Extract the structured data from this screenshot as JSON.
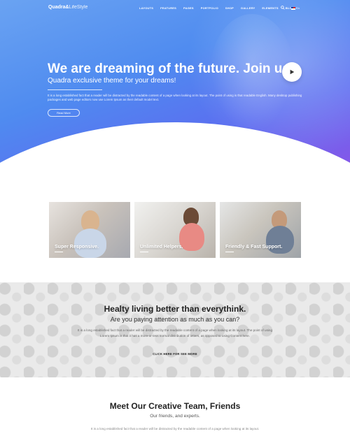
{
  "nav": {
    "logo_bold": "Quadra&",
    "logo_light": "LifeStyle",
    "menu": [
      "LAYOUTS",
      "FEATURES",
      "PAGES",
      "PORTFOLIO",
      "SHOP",
      "GALLERY",
      "ELEMENTS",
      "BLOG"
    ],
    "language": "En"
  },
  "hero": {
    "title": "We are dreaming of the future. Join us.",
    "subtitle": "Quadra exclusive theme for your dreams!",
    "text": "It is a long established fact that a reader will be distracted by the readable content of a page when looking at its layout. The point of using is that readable English. Many desktop publishing packages and web page editors now use Lorem Ipsum as their default model text.",
    "button": "Read More"
  },
  "cards": [
    {
      "title": "Super Responsive."
    },
    {
      "title": "Unlimited Helpers."
    },
    {
      "title": "Friendly & Fast Support."
    }
  ],
  "health": {
    "title": "Healty living better than everythink.",
    "subtitle": "Are you paying attention as much as you can?",
    "text": "It is a long established fact that a reader will be distracted by the readable content of a page when looking at its layout. The point of using Lorem Ipsum is that it has a more-or-less normal distribution of letters, as opposed to using Content here.",
    "link": "CLICK HERE FOR SEE MORE"
  },
  "team": {
    "title": "Meet Our Creative Team, Friends",
    "subtitle": "Our friends, and experts.",
    "text": "It is a long established fact that a reader will be distracted by the readable content of a page when looking at its layout."
  },
  "colors": {
    "accent": "#4f8bf0",
    "accent_purple": "#8a55e8"
  },
  "icons": {
    "search": "search-icon",
    "play": "play-icon",
    "flag": "us-flag-icon"
  }
}
